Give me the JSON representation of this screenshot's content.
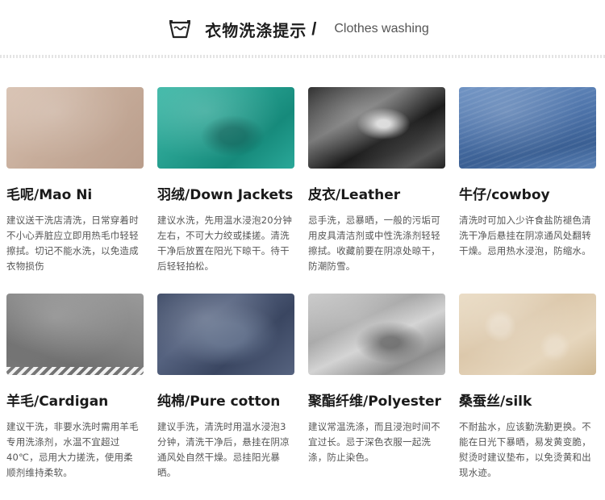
{
  "header": {
    "title_cn": "衣物洗涤提示",
    "separator": "/",
    "title_en": "Clothes washing",
    "icon": "wash-basin-icon"
  },
  "fabrics": [
    {
      "name": "毛呢/Mao Ni",
      "desc": "建议送干洗店清洗，日常穿着时不小心弄脏应立即用热毛巾轻轻擦拭。切记不能水洗，以免造成衣物损伤",
      "swatch_color": "#c9ae9b"
    },
    {
      "name": "羽绒/Down Jackets",
      "desc": "建议水洗，先用温水浸泡20分钟左右，不可大力绞或揉搓。清洗干净后放置在阳光下晾干。待干后轻轻拍松。",
      "swatch_color": "#27a090"
    },
    {
      "name": "皮衣/Leather",
      "desc": "忌手洗，忌暴晒，一般的污垢可用皮具清洁剂或中性洗涤剂轻轻擦拭。收藏前要在阴凉处晾干，防潮防雪。",
      "swatch_color": "#2a2a2a"
    },
    {
      "name": "牛仔/cowboy",
      "desc": "清洗时可加入少许食盐防褪色清洗干净后悬挂在阴凉通风处翻转干燥。忌用热水浸泡，防缩水。",
      "swatch_color": "#4c72a8"
    },
    {
      "name": "羊毛/Cardigan",
      "desc": "建议干洗，非要水洗时需用羊毛专用洗涤剂，水温不宜超过40℃，忌用大力搓洗，使用柔顺剂维持柔软。",
      "swatch_color": "#868686"
    },
    {
      "name": "纯棉/Pure cotton",
      "desc": "建议手洗，清洗时用温水浸泡3分钟，清洗干净后，悬挂在阴凉通风处自然干燥。忌挂阳光暴晒。",
      "swatch_color": "#4a5672"
    },
    {
      "name": "聚酯纤维/Polyester",
      "desc": "建议常温洗涤，而且浸泡时间不宜过长。忌于深色衣服一起洗涤，防止染色。",
      "swatch_color": "#a7a7a7"
    },
    {
      "name": "桑蚕丝/silk",
      "desc": "不耐盐水，应该勤洗勤更换。不能在日光下暴晒，易发黄变脆，熨烫时建议垫布，以免烫黄和出现水迹。",
      "swatch_color": "#dcc8ab"
    }
  ]
}
